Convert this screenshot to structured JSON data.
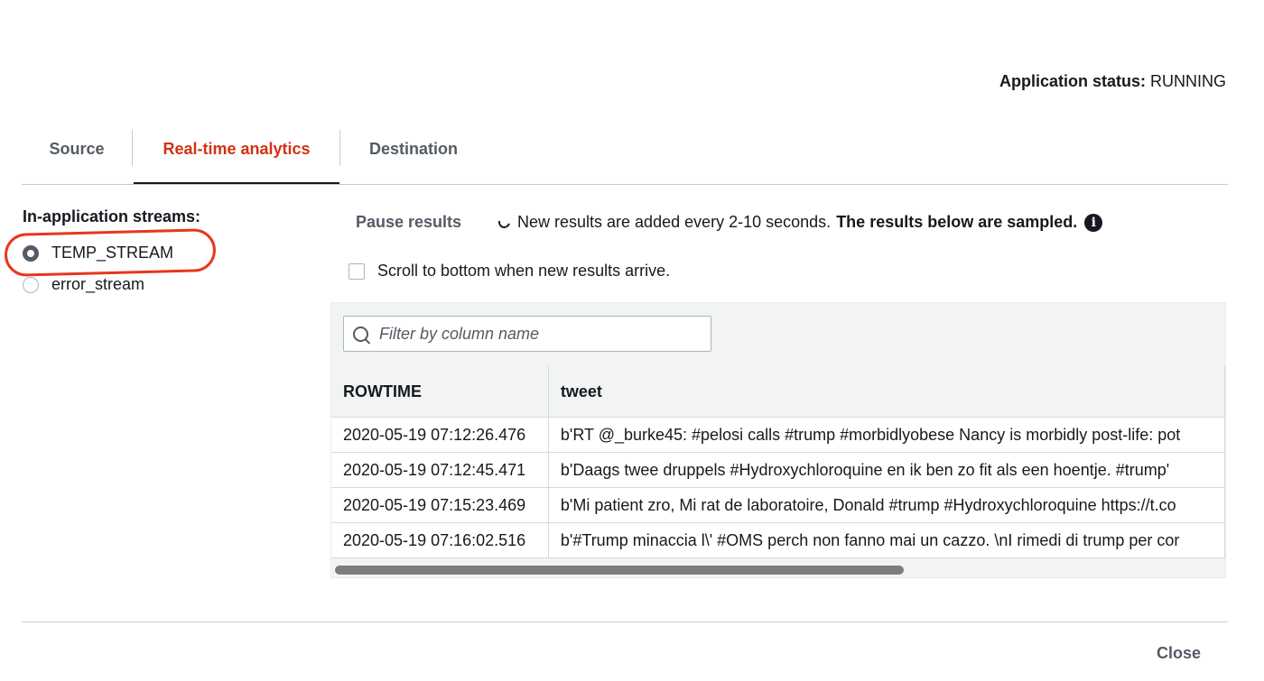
{
  "status": {
    "label": "Application status:",
    "value": "RUNNING"
  },
  "tabs": [
    {
      "label": "Source"
    },
    {
      "label": "Real-time analytics",
      "active": true
    },
    {
      "label": "Destination"
    }
  ],
  "streams": {
    "label": "In-application streams:",
    "options": [
      {
        "label": "TEMP_STREAM",
        "selected": true
      },
      {
        "label": "error_stream",
        "selected": false
      }
    ]
  },
  "controls": {
    "pause_label": "Pause results",
    "info_text": "New results are added every 2-10 seconds.",
    "info_bold": "The results below are sampled.",
    "scroll_label": "Scroll to bottom when new results arrive."
  },
  "table": {
    "filter_placeholder": "Filter by column name",
    "columns": [
      "ROWTIME",
      "tweet"
    ],
    "rows": [
      [
        "2020-05-19 07:12:26.476",
        "b'RT @_burke45: #pelosi calls #trump #morbidlyobese Nancy is morbidly post-life: pot"
      ],
      [
        "2020-05-19 07:12:45.471",
        "b'Daags twee druppels #Hydroxychloroquine en ik ben zo fit als een hoentje. #trump'"
      ],
      [
        "2020-05-19 07:15:23.469",
        "b'Mi patient zro, Mi rat de laboratoire, Donald #trump #Hydroxychloroquine https://t.co"
      ],
      [
        "2020-05-19 07:16:02.516",
        "b'#Trump minaccia l\\' #OMS perch non fanno mai un cazzo. \\nI rimedi di trump per cor"
      ]
    ]
  },
  "footer": {
    "close_label": "Close"
  },
  "colors": {
    "active_tab": "#d13212",
    "annotation": "#e8361c"
  }
}
